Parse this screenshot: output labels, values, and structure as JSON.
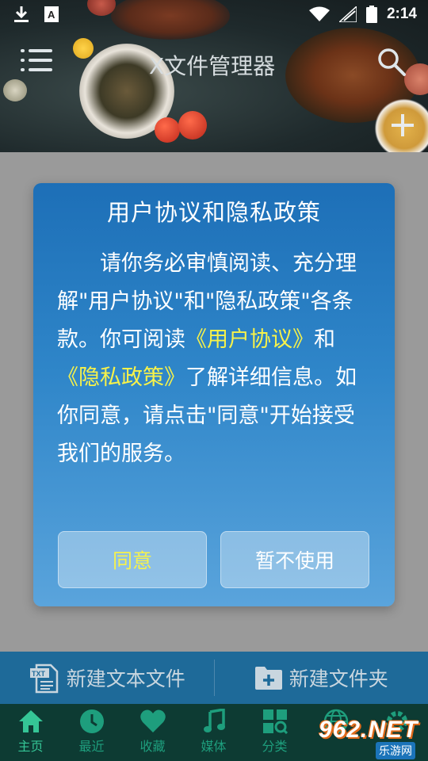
{
  "status_bar": {
    "time": "2:14"
  },
  "toolbar": {
    "title": "X文件管理器"
  },
  "dialog": {
    "title": "用户协议和隐私政策",
    "body_part1": "请你务必审慎阅读、充分理解\"用户协议\"和\"隐私政策\"各条款。你可阅读",
    "link_user_agreement": "《用户协议》",
    "body_part2": "和",
    "link_privacy_policy": "《隐私政策》",
    "body_part3": "了解详细信息。如你同意，请点击\"同意\"开始接受我们的服务。",
    "agree_label": "同意",
    "decline_label": "暂不使用",
    "colors": {
      "accent_link": "#f7f24a",
      "background_top": "#1d6fb7",
      "background_bottom": "#5aa4dc"
    }
  },
  "action_bar": {
    "new_text_file": "新建文本文件",
    "new_folder": "新建文件夹",
    "txt_icon_label": "TXT"
  },
  "bottom_nav": {
    "items": [
      {
        "label": "主页",
        "icon": "home-icon",
        "active": true
      },
      {
        "label": "最近",
        "icon": "clock-icon",
        "active": false
      },
      {
        "label": "收藏",
        "icon": "heart-icon",
        "active": false
      },
      {
        "label": "媒体",
        "icon": "music-note-icon",
        "active": false
      },
      {
        "label": "分类",
        "icon": "category-grid-icon",
        "active": false
      },
      {
        "label": "",
        "icon": "globe-icon",
        "active": false
      },
      {
        "label": "",
        "icon": "gear-icon",
        "active": false
      }
    ]
  },
  "watermark": {
    "number": "962.NET",
    "site": "乐游网"
  }
}
